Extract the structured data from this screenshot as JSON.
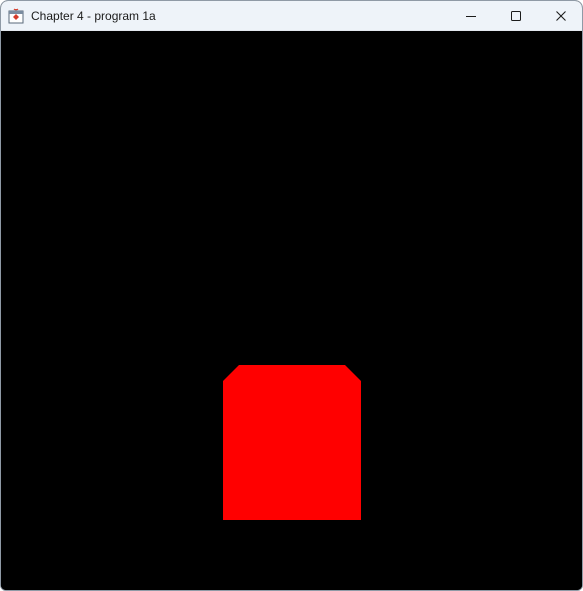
{
  "window": {
    "title": "Chapter 4 - program 1a",
    "app_icon": "java-app-icon",
    "controls": {
      "minimize": "minimize-icon",
      "maximize": "maximize-icon",
      "close": "close-icon"
    }
  },
  "canvas": {
    "background": "#000000",
    "shape": {
      "description_color": "red",
      "fill": "#ff0000"
    }
  }
}
